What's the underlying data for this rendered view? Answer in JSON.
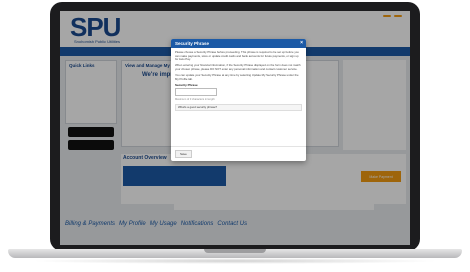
{
  "brand": {
    "logo_text": "SPU",
    "logo_sub": "Snohomish Public Utilities"
  },
  "modal": {
    "title": "Security Phrase",
    "close": "×",
    "para1": "Please choose a Security Phrase before proceeding. This phrase is required to be set up before you can make payments, store or update credit cards and bank accounts for future payments, or sign up for Auto Pay.",
    "para2": "When entering your financial information, if the Security Phrase displayed on the form does not match your chosen phrase, please DO NOT enter any personal information and contact customer service.",
    "para3": "You can update your Security Phrase at any time by selecting Update My Security Phrase under the My Profile tab.",
    "field_label": "Security Phrase",
    "hint": "Maximum of 3 characters in length",
    "faq": "What's a good security phrase?",
    "save": "Save"
  },
  "page": {
    "quick_links": "Quick Links",
    "view_manage": "View and Manage My",
    "impress": "We're impro",
    "account_overview": "Account Overview",
    "pay_now": "Make Payment"
  },
  "footer": {
    "links": [
      "Billing & Payments",
      "My Profile",
      "My Usage",
      "Notifications",
      "Contact Us"
    ]
  }
}
